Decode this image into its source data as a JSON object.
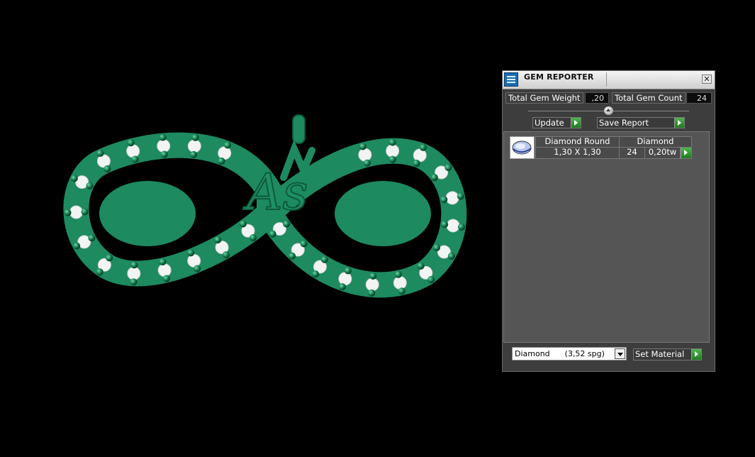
{
  "viewport": {
    "model_colors": {
      "metal": "#1d8a60",
      "metal_dark": "#0e5a3c",
      "diamond": "#f2f4f4",
      "prong": "#0f6b44"
    }
  },
  "panel": {
    "title": "GEM REPORTER",
    "close_label": "✕",
    "total_gem_weight_label": "Total Gem Weight",
    "total_gem_weight_value": ",20",
    "total_gem_count_label": "Total Gem Count",
    "total_gem_count_value": "24",
    "update_label": "Update",
    "save_report_label": "Save Report",
    "report": {
      "headers": [
        "Diamond Round",
        "Diamond"
      ],
      "rows": [
        {
          "size": "1,30 X 1,30",
          "count": "24",
          "weight": "0,20tw"
        }
      ]
    },
    "material_select_value": "Diamond      (3,52 spg)",
    "set_material_label": "Set Material",
    "colors": {
      "go_button": "#2e9a2e"
    }
  }
}
